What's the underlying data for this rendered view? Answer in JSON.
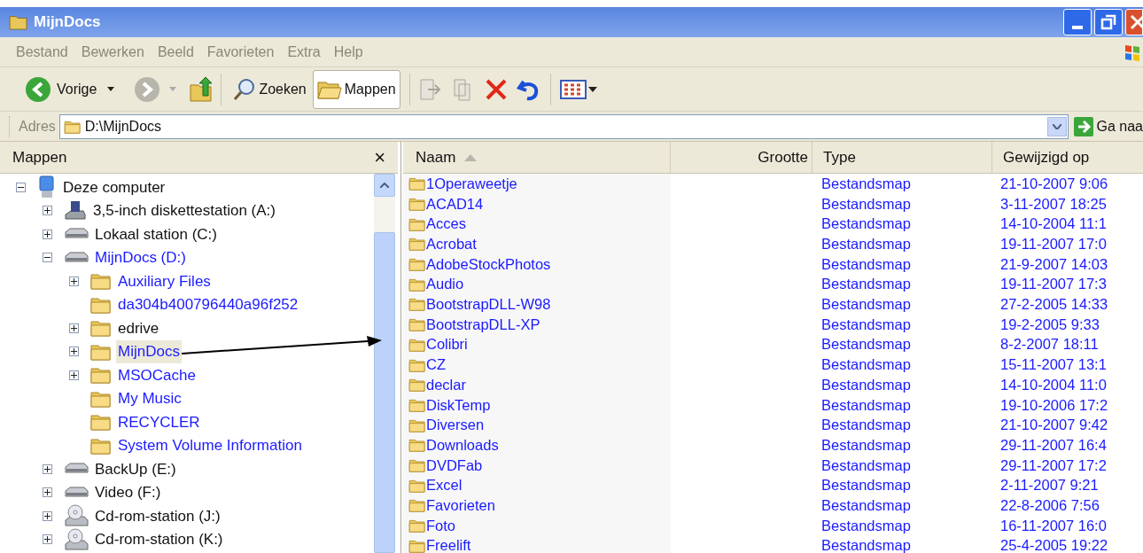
{
  "window": {
    "title": "MijnDocs"
  },
  "menu": [
    "Bestand",
    "Bewerken",
    "Beeld",
    "Favorieten",
    "Extra",
    "Help"
  ],
  "toolbar": {
    "back": {
      "label": "Vorige"
    },
    "buttons": [
      {
        "kind": "search",
        "label": "Zoeken",
        "selected": false
      },
      {
        "kind": "folders",
        "label": "Mappen",
        "selected": true
      }
    ]
  },
  "address": {
    "label": "Adres",
    "value": "D:\\MijnDocs",
    "go": "Ga naa"
  },
  "folders_pane": {
    "title": "Mappen",
    "close": "×",
    "tree": [
      {
        "label": "Deze computer",
        "kind": "computer",
        "expanded": true,
        "selected": false,
        "compressed": false,
        "children": [
          {
            "label": "3,5-inch diskettestation (A:)",
            "kind": "floppy",
            "expanded": false,
            "selected": false,
            "compressed": false
          },
          {
            "label": "Lokaal station (C:)",
            "kind": "drive",
            "expanded": false,
            "selected": false,
            "compressed": false
          },
          {
            "label": "MijnDocs (D:)",
            "kind": "drive",
            "expanded": true,
            "selected": false,
            "compressed": true,
            "children": [
              {
                "label": "Auxiliary Files",
                "kind": "folder",
                "expanded": false,
                "selected": false,
                "compressed": true
              },
              {
                "label": "da304b400796440a96f252",
                "kind": "folder",
                "selected": false,
                "compressed": true
              },
              {
                "label": "edrive",
                "kind": "folder",
                "expanded": false,
                "selected": false,
                "compressed": false
              },
              {
                "label": "MijnDocs",
                "kind": "folder",
                "expanded": false,
                "selected": true,
                "compressed": true
              },
              {
                "label": "MSOCache",
                "kind": "folder",
                "expanded": false,
                "selected": false,
                "compressed": true
              },
              {
                "label": "My Music",
                "kind": "folder",
                "selected": false,
                "compressed": true
              },
              {
                "label": "RECYCLER",
                "kind": "folder",
                "selected": false,
                "compressed": true
              },
              {
                "label": "System Volume Information",
                "kind": "folder",
                "selected": false,
                "compressed": true
              }
            ]
          },
          {
            "label": "BackUp (E:)",
            "kind": "drive",
            "expanded": false,
            "selected": false,
            "compressed": false
          },
          {
            "label": "Video (F:)",
            "kind": "drive",
            "expanded": false,
            "selected": false,
            "compressed": false
          },
          {
            "label": "Cd-rom-station (J:)",
            "kind": "cdrom",
            "expanded": false,
            "selected": false,
            "compressed": false
          },
          {
            "label": "Cd-rom-station (K:)",
            "kind": "cdrom",
            "expanded": false,
            "selected": false,
            "compressed": false
          }
        ]
      }
    ]
  },
  "table": {
    "columns": [
      "Naam",
      "Grootte",
      "Type",
      "Gewijzigd op"
    ],
    "rows": [
      {
        "name": "1Operaweetje",
        "type": "Bestandsmap",
        "modified": "21-10-2007 9:06",
        "compressed": true
      },
      {
        "name": "ACAD14",
        "type": "Bestandsmap",
        "modified": "3-11-2007 18:25",
        "compressed": true
      },
      {
        "name": "Acces",
        "type": "Bestandsmap",
        "modified": "14-10-2004 11:1",
        "compressed": true
      },
      {
        "name": "Acrobat",
        "type": "Bestandsmap",
        "modified": "19-11-2007 17:0",
        "compressed": true
      },
      {
        "name": "AdobeStockPhotos",
        "type": "Bestandsmap",
        "modified": "21-9-2007 14:03",
        "compressed": true
      },
      {
        "name": "Audio",
        "type": "Bestandsmap",
        "modified": "19-11-2007 17:3",
        "compressed": true
      },
      {
        "name": "BootstrapDLL-W98",
        "type": "Bestandsmap",
        "modified": "27-2-2005 14:33",
        "compressed": true
      },
      {
        "name": "BootstrapDLL-XP",
        "type": "Bestandsmap",
        "modified": "19-2-2005 9:33",
        "compressed": true
      },
      {
        "name": "Colibri",
        "type": "Bestandsmap",
        "modified": "8-2-2007 18:11",
        "compressed": true
      },
      {
        "name": "CZ",
        "type": "Bestandsmap",
        "modified": "15-11-2007 13:1",
        "compressed": true
      },
      {
        "name": "declar",
        "type": "Bestandsmap",
        "modified": "14-10-2004 11:0",
        "compressed": true
      },
      {
        "name": "DiskTemp",
        "type": "Bestandsmap",
        "modified": "19-10-2006 17:2",
        "compressed": true
      },
      {
        "name": "Diversen",
        "type": "Bestandsmap",
        "modified": "21-10-2007 9:42",
        "compressed": true
      },
      {
        "name": "Downloads",
        "type": "Bestandsmap",
        "modified": "29-11-2007 16:4",
        "compressed": true
      },
      {
        "name": "DVDFab",
        "type": "Bestandsmap",
        "modified": "29-11-2007 17:2",
        "compressed": true
      },
      {
        "name": "Excel",
        "type": "Bestandsmap",
        "modified": "2-11-2007 9:21",
        "compressed": true
      },
      {
        "name": "Favorieten",
        "type": "Bestandsmap",
        "modified": "22-8-2006 7:56",
        "compressed": true
      },
      {
        "name": "Foto",
        "type": "Bestandsmap",
        "modified": "16-11-2007 16:0",
        "compressed": true
      },
      {
        "name": "Freelift",
        "type": "Bestandsmap",
        "modified": "25-4-2005 19:22",
        "compressed": true
      }
    ]
  }
}
